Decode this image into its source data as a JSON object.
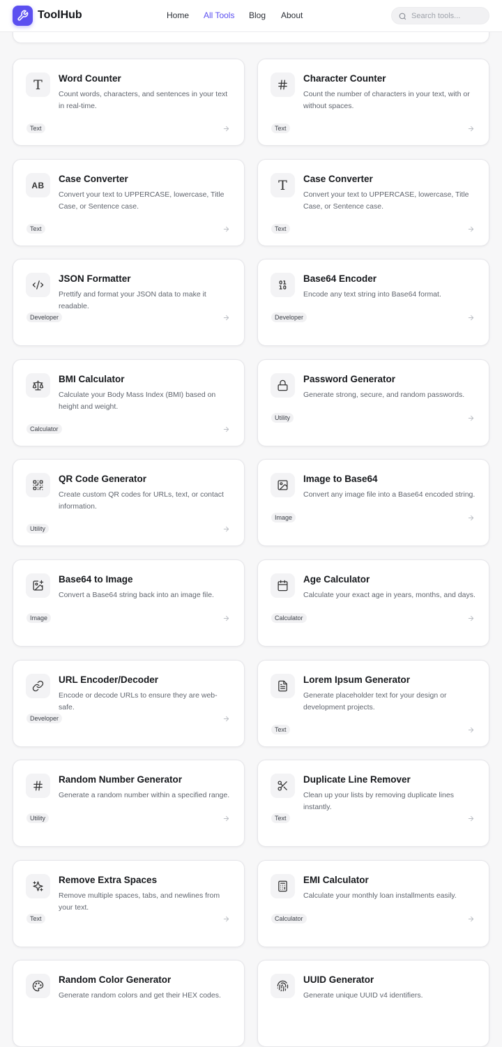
{
  "header": {
    "brand": "ToolHub",
    "nav": [
      {
        "label": "Home",
        "active": false
      },
      {
        "label": "All Tools",
        "active": true
      },
      {
        "label": "Blog",
        "active": false
      },
      {
        "label": "About",
        "active": false
      }
    ],
    "search_placeholder": "Search tools..."
  },
  "colors": {
    "accent": "#5b4ff0",
    "background": "#f7f7f8",
    "card": "#ffffff"
  },
  "tools": [
    {
      "title": "Word Counter",
      "desc": "Count words, characters, and sentences in your text in real-time.",
      "tag": "Text",
      "icon": "text-type-icon"
    },
    {
      "title": "Character Counter",
      "desc": "Count the number of characters in your text, with or without spaces.",
      "tag": "Text",
      "icon": "hash-icon"
    },
    {
      "title": "Case Converter",
      "desc": "Convert your text to UPPERCASE, lowercase, Title Case, or Sentence case.",
      "tag": "Text",
      "icon": "ab-case-icon"
    },
    {
      "title": "Case Converter",
      "desc": "Convert your text to UPPERCASE, lowercase, Title Case, or Sentence case.",
      "tag": "Text",
      "icon": "text-type-icon"
    },
    {
      "title": "JSON Formatter",
      "desc": "Prettify and format your JSON data to make it readable.",
      "tag": "Developer",
      "icon": "code-icon"
    },
    {
      "title": "Base64 Encoder",
      "desc": "Encode any text string into Base64 format.",
      "tag": "Developer",
      "icon": "binary-icon"
    },
    {
      "title": "BMI Calculator",
      "desc": "Calculate your Body Mass Index (BMI) based on height and weight.",
      "tag": "Calculator",
      "icon": "scale-icon"
    },
    {
      "title": "Password Generator",
      "desc": "Generate strong, secure, and random passwords.",
      "tag": "Utility",
      "icon": "lock-icon"
    },
    {
      "title": "QR Code Generator",
      "desc": "Create custom QR codes for URLs, text, or contact information.",
      "tag": "Utility",
      "icon": "qr-code-icon"
    },
    {
      "title": "Image to Base64",
      "desc": "Convert any image file into a Base64 encoded string.",
      "tag": "Image",
      "icon": "image-icon"
    },
    {
      "title": "Base64 to Image",
      "desc": "Convert a Base64 string back into an image file.",
      "tag": "Image",
      "icon": "image-plus-icon"
    },
    {
      "title": "Age Calculator",
      "desc": "Calculate your exact age in years, months, and days.",
      "tag": "Calculator",
      "icon": "calendar-icon"
    },
    {
      "title": "URL Encoder/Decoder",
      "desc": "Encode or decode URLs to ensure they are web-safe.",
      "tag": "Developer",
      "icon": "link-icon"
    },
    {
      "title": "Lorem Ipsum Generator",
      "desc": "Generate placeholder text for your design or development projects.",
      "tag": "Text",
      "icon": "file-text-icon"
    },
    {
      "title": "Random Number Generator",
      "desc": "Generate a random number within a specified range.",
      "tag": "Utility",
      "icon": "hash-icon"
    },
    {
      "title": "Duplicate Line Remover",
      "desc": "Clean up your lists by removing duplicate lines instantly.",
      "tag": "Text",
      "icon": "scissors-icon"
    },
    {
      "title": "Remove Extra Spaces",
      "desc": "Remove multiple spaces, tabs, and newlines from your text.",
      "tag": "Text",
      "icon": "sparkles-icon"
    },
    {
      "title": "EMI Calculator",
      "desc": "Calculate your monthly loan installments easily.",
      "tag": "Calculator",
      "icon": "calculator-icon"
    },
    {
      "title": "Random Color Generator",
      "desc": "Generate random colors and get their HEX codes.",
      "tag": "",
      "icon": "palette-icon"
    },
    {
      "title": "UUID Generator",
      "desc": "Generate unique UUID v4 identifiers.",
      "tag": "",
      "icon": "fingerprint-icon"
    }
  ]
}
